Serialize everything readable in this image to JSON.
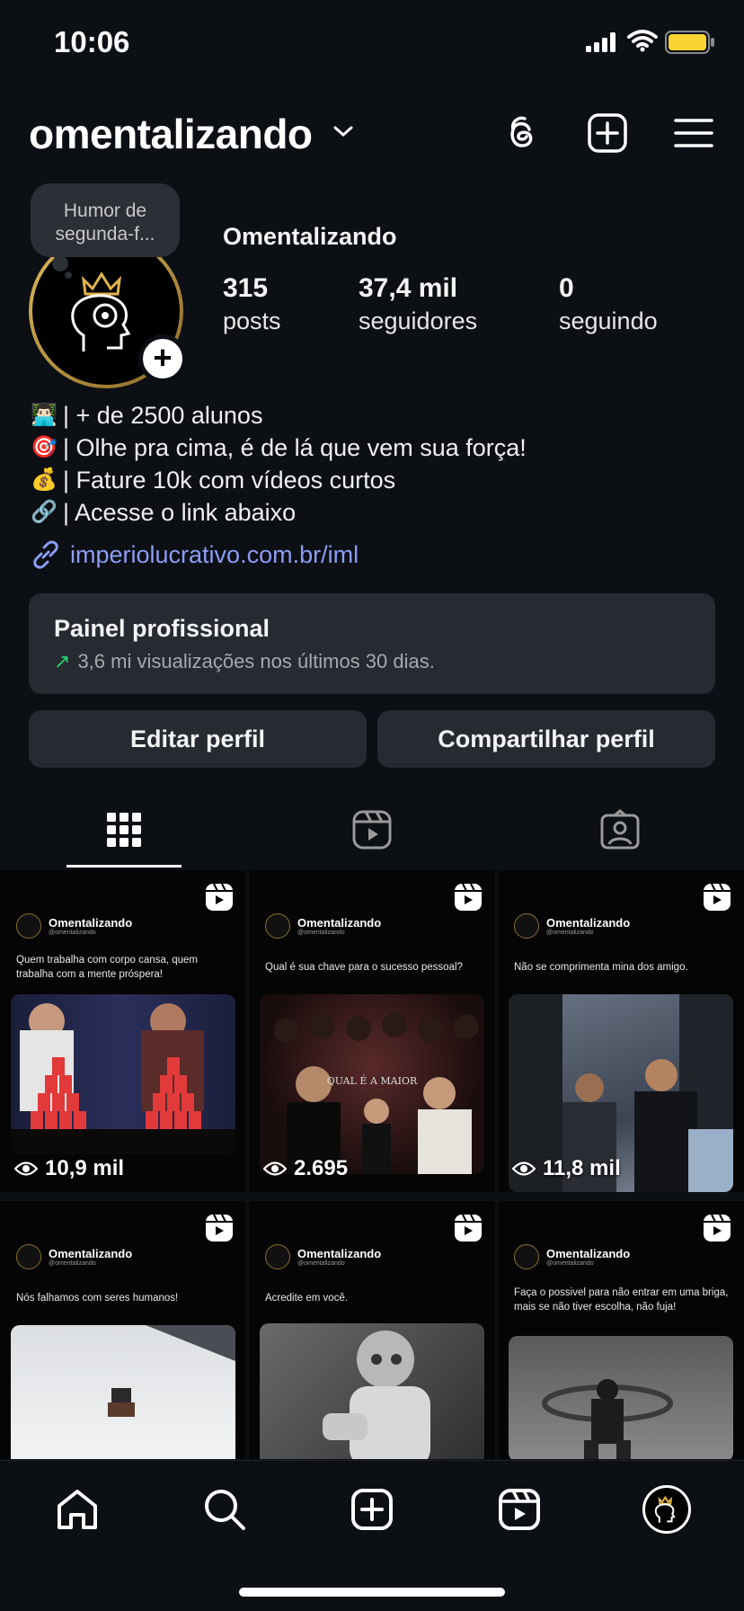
{
  "status_bar": {
    "time": "10:06"
  },
  "header": {
    "username": "omentalizando"
  },
  "profile": {
    "note": "Humor de segunda-f...",
    "display_name": "Omentalizando",
    "stats": [
      {
        "num": "315",
        "label": "posts"
      },
      {
        "num": "37,4 mil",
        "label": "seguidores"
      },
      {
        "num": "0",
        "label": "seguindo"
      }
    ],
    "bio": [
      {
        "emoji": "👨🏻‍💻",
        "text": "| + de 2500 alunos"
      },
      {
        "emoji": "🎯",
        "text": "| Olhe pra cima, é de lá que vem sua força!"
      },
      {
        "emoji": "💰",
        "text": "| Fature 10k com vídeos curtos"
      },
      {
        "emoji": "🔗",
        "text": "| Acesse o link abaixo"
      }
    ],
    "link": "imperiolucrativo.com.br/iml"
  },
  "dashboard": {
    "title": "Painel profissional",
    "subtitle": "3,6 mi visualizações nos últimos 30 dias."
  },
  "buttons": {
    "edit": "Editar perfil",
    "share": "Compartilhar perfil"
  },
  "posts": [
    {
      "brand": "Omentalizando",
      "handle": "@omentalizando",
      "caption": "Quem trabalha com corpo cansa, quem trabalha com a mente próspera!",
      "views": "10,9 mil"
    },
    {
      "brand": "Omentalizando",
      "handle": "@omentalizando",
      "caption": "Qual é sua chave para o sucesso pessoal?",
      "views": "2.695",
      "overlay": "QUAL É A MAIOR"
    },
    {
      "brand": "Omentalizando",
      "handle": "@omentalizando",
      "caption": "Não se comprimenta mina dos amigo.",
      "views": "11,8 mil"
    },
    {
      "brand": "Omentalizando",
      "handle": "@omentalizando",
      "caption": "Nós falhamos com seres humanos!",
      "views": ""
    },
    {
      "brand": "Omentalizando",
      "handle": "@omentalizando",
      "caption": "Acredite em você.",
      "views": ""
    },
    {
      "brand": "Omentalizando",
      "handle": "@omentalizando",
      "caption": "Faça o possivel para não entrar em uma briga, mais se não tiver escolha, não fuja!",
      "views": ""
    }
  ]
}
